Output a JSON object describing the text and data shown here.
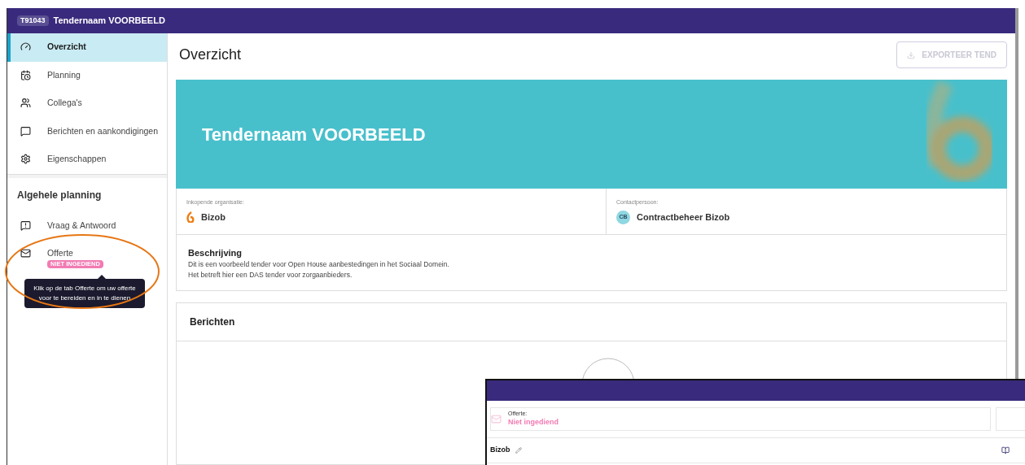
{
  "window": {
    "code": "T91043",
    "title": "Tendernaam VOORBEELD"
  },
  "sidebar": {
    "items": [
      {
        "label": "Overzicht",
        "selected": true
      },
      {
        "label": "Planning",
        "selected": false
      },
      {
        "label": "Collega's",
        "selected": false
      },
      {
        "label": "Berichten en aankondigingen",
        "selected": false
      },
      {
        "label": "Eigenschappen",
        "selected": false
      }
    ],
    "section_title": "Algehele planning",
    "section_items": [
      {
        "label": "Vraag & Antwoord",
        "selected": false
      },
      {
        "label": "Offerte",
        "badge": "NIET INGEDIEND",
        "selected": false
      }
    ]
  },
  "tooltip": "Klik op de tab Offerte om uw offerte voor te bereiden en in te dienen",
  "page": {
    "title": "Overzicht",
    "export_button": "EXPORTEER TEND",
    "banner_title": "Tendernaam VOORBEELD",
    "organisation": {
      "label": "Inkopende organisatie:",
      "value": "Bizob"
    },
    "contact": {
      "label": "Contactpersoon:",
      "initials": "CB",
      "value": "Contractbeheer Bizob"
    },
    "description": {
      "title": "Beschrijving",
      "lines": [
        "Dit is een voorbeeld tender voor Open House aanbestedingen in het Sociaal Domein.",
        "Het betreft hier een DAS tender voor zorgaanbieders."
      ]
    },
    "messages": {
      "title": "Berichten"
    }
  },
  "inset": {
    "status_label": "Offerte:",
    "status": "Niet ingediend",
    "name": "Bizob"
  }
}
